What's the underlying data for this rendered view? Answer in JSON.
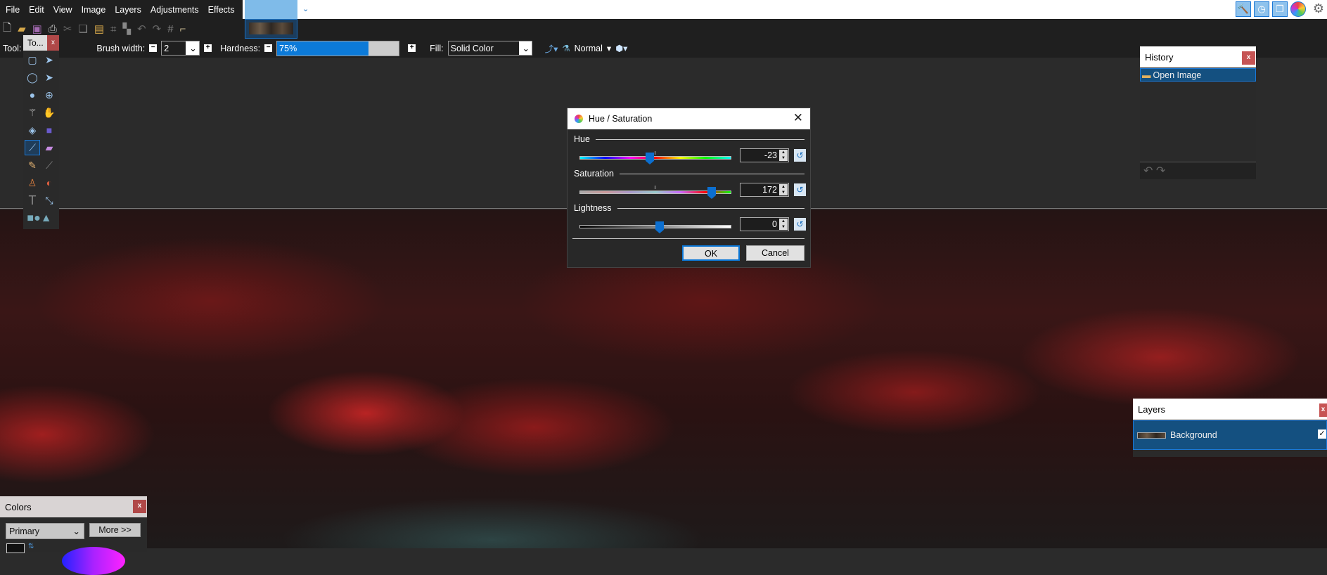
{
  "menu": [
    "File",
    "Edit",
    "View",
    "Image",
    "Layers",
    "Adjustments",
    "Effects"
  ],
  "top_right_icons": [
    "tools-icon",
    "history-icon",
    "layers-icon",
    "colors-icon",
    "settings-icon"
  ],
  "toolbar": {
    "tool_label": "Tool:",
    "brush_width_label": "Brush width:",
    "brush_width": "2",
    "hardness_label": "Hardness:",
    "hardness": "75%",
    "hardness_value": 75,
    "fill_label": "Fill:",
    "fill": "Solid Color",
    "blend_mode": "Normal"
  },
  "toolbox": {
    "title": "To...",
    "close": "x"
  },
  "dialog": {
    "title": "Hue / Saturation",
    "hue_label": "Hue",
    "hue": "-23",
    "saturation_label": "Saturation",
    "saturation": "172",
    "lightness_label": "Lightness",
    "lightness": "0",
    "ok": "OK",
    "cancel": "Cancel"
  },
  "history": {
    "title": "History",
    "close": "x",
    "items": [
      "Open Image"
    ]
  },
  "layers": {
    "title": "Layers",
    "close": "x",
    "items": [
      {
        "name": "Background",
        "visible": true
      }
    ]
  },
  "colors": {
    "title": "Colors",
    "close": "x",
    "mode": "Primary",
    "more": "More >>"
  }
}
